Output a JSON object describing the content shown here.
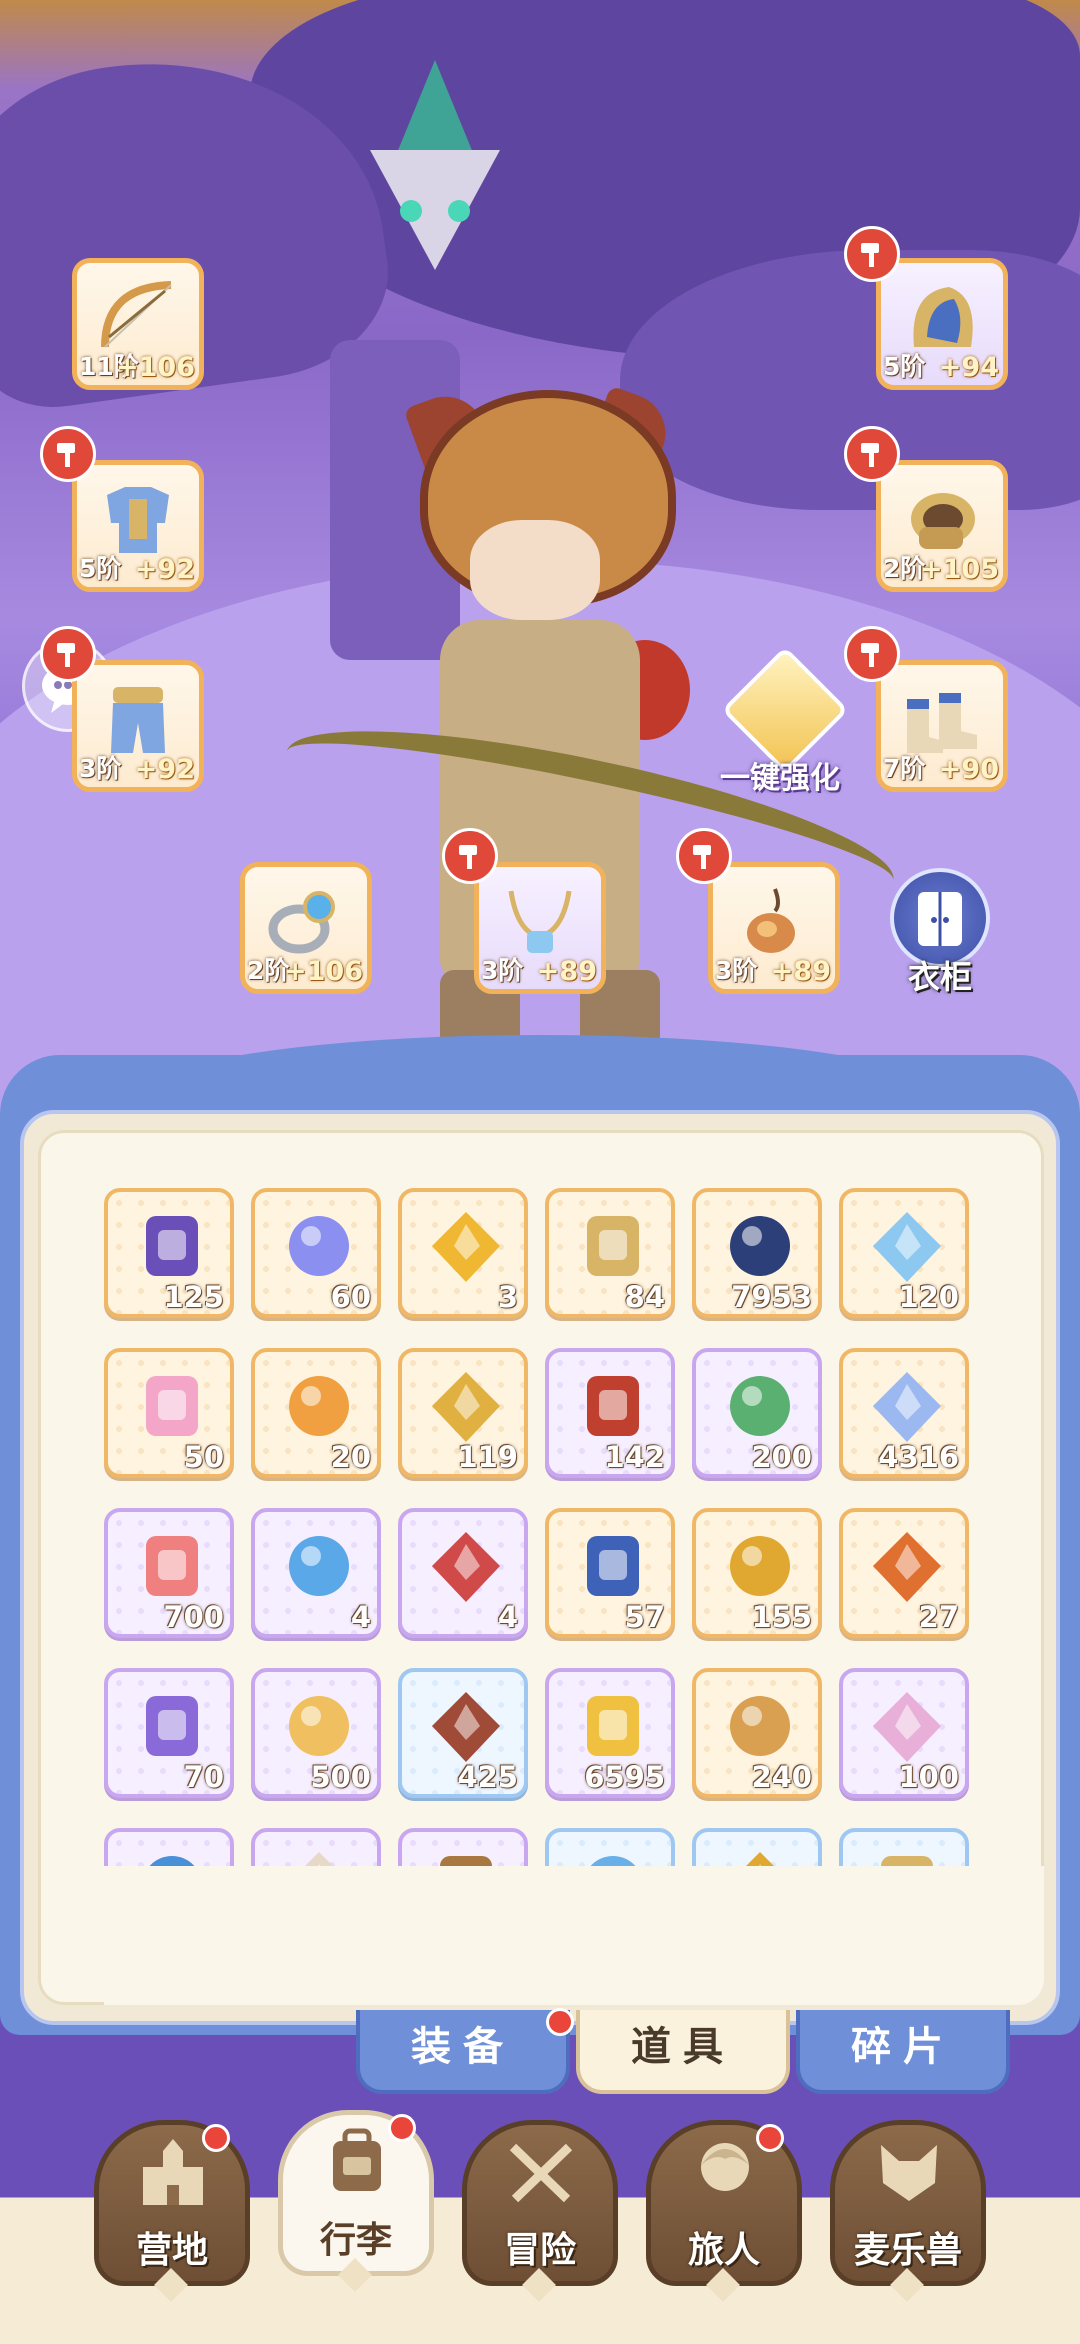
{
  "equipment": {
    "bow": {
      "level": "11阶",
      "bonus": "+106"
    },
    "helmet": {
      "level": "5阶",
      "bonus": "+94"
    },
    "armor": {
      "level": "5阶",
      "bonus": "+92"
    },
    "gauntlet": {
      "level": "2阶",
      "bonus": "+105"
    },
    "pants": {
      "level": "3阶",
      "bonus": "+92"
    },
    "boots": {
      "level": "7阶",
      "bonus": "+90"
    },
    "ring": {
      "level": "2阶",
      "bonus": "+106"
    },
    "necklace": {
      "level": "3阶",
      "bonus": "+89"
    },
    "charm": {
      "level": "3阶",
      "bonus": "+89"
    }
  },
  "actions": {
    "enhance_all": "一键强化",
    "wardrobe": "衣柜"
  },
  "inventory": {
    "items": [
      {
        "icon": "ticket-icon",
        "count": "125",
        "frame": "orange"
      },
      {
        "icon": "paper-plane-icon",
        "count": "60",
        "frame": "orange"
      },
      {
        "icon": "gold-crystal-icon",
        "count": "3",
        "frame": "orange"
      },
      {
        "icon": "lyre-icon",
        "count": "84",
        "frame": "orange"
      },
      {
        "icon": "orb-icon",
        "count": "7953",
        "frame": "orange"
      },
      {
        "icon": "ice-crystal-icon",
        "count": "120",
        "frame": "orange"
      },
      {
        "icon": "paint-tube-icon",
        "count": "50",
        "frame": "orange"
      },
      {
        "icon": "outfit-card-icon",
        "count": "20",
        "frame": "orange"
      },
      {
        "icon": "bell-icon",
        "count": "119",
        "frame": "orange"
      },
      {
        "icon": "horseshoe-icon",
        "count": "142",
        "frame": "purple"
      },
      {
        "icon": "potion-bottle-icon",
        "count": "200",
        "frame": "purple"
      },
      {
        "icon": "star-crystal-icon",
        "count": "4316",
        "frame": "orange"
      },
      {
        "icon": "heart-icon",
        "count": "700",
        "frame": "purple"
      },
      {
        "icon": "blue-potion-icon",
        "count": "4",
        "frame": "purple"
      },
      {
        "icon": "red-potion-icon",
        "count": "4",
        "frame": "purple"
      },
      {
        "icon": "blue-eye-card-icon",
        "count": "57",
        "frame": "orange"
      },
      {
        "icon": "gold-eye-card-icon",
        "count": "155",
        "frame": "orange"
      },
      {
        "icon": "red-eye-card-icon",
        "count": "27",
        "frame": "orange"
      },
      {
        "icon": "cat-mirror-icon",
        "count": "70",
        "frame": "purple"
      },
      {
        "icon": "cheese-icon",
        "count": "500",
        "frame": "purple"
      },
      {
        "icon": "meat-icon",
        "count": "425",
        "frame": "blue"
      },
      {
        "icon": "gold-leaf-icon",
        "count": "6595",
        "frame": "purple"
      },
      {
        "icon": "cookie-star-icon",
        "count": "240",
        "frame": "orange"
      },
      {
        "icon": "pink-tube-icon",
        "count": "100",
        "frame": "purple"
      }
    ],
    "partial_row": [
      {
        "icon": "blue-gem-icon",
        "frame": "purple"
      },
      {
        "icon": "scroll-icon",
        "frame": "purple"
      },
      {
        "icon": "book-icon",
        "frame": "purple"
      },
      {
        "icon": "ice-shard-icon",
        "frame": "blue"
      },
      {
        "icon": "feather-icon",
        "frame": "blue"
      },
      {
        "icon": "cat-badge-icon",
        "frame": "blue"
      }
    ]
  },
  "bag_tabs": [
    {
      "label": "装备",
      "active": false
    },
    {
      "label": "道具",
      "active": true
    },
    {
      "label": "碎片",
      "active": false
    }
  ],
  "nav": [
    {
      "label": "营地",
      "icon": "castle-icon",
      "active": false
    },
    {
      "label": "行李",
      "icon": "backpack-icon",
      "active": true
    },
    {
      "label": "冒险",
      "icon": "crossed-swords-icon",
      "active": false
    },
    {
      "label": "旅人",
      "icon": "traveler-icon",
      "active": false
    },
    {
      "label": "麦乐兽",
      "icon": "cat-beast-icon",
      "active": false
    }
  ],
  "colors": {
    "notify": "#e9453a",
    "frame_orange": "#f0b866",
    "frame_purple": "#c9a7f0",
    "frame_blue": "#9ec7f2"
  }
}
